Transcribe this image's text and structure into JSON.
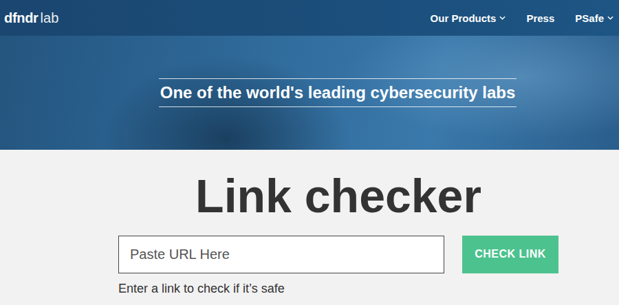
{
  "logo": {
    "brand": "dfndr",
    "suffix": "lab"
  },
  "nav": [
    {
      "label": "Our Products",
      "has_menu": true
    },
    {
      "label": "Press",
      "has_menu": false
    },
    {
      "label": "PSafe",
      "has_menu": true
    }
  ],
  "hero": {
    "tagline": "One of the world's leading cybersecurity labs"
  },
  "checker": {
    "title": "Link checker",
    "placeholder": "Paste URL Here",
    "button": "CHECK LINK",
    "hint": "Enter a link to check if it’s safe"
  }
}
